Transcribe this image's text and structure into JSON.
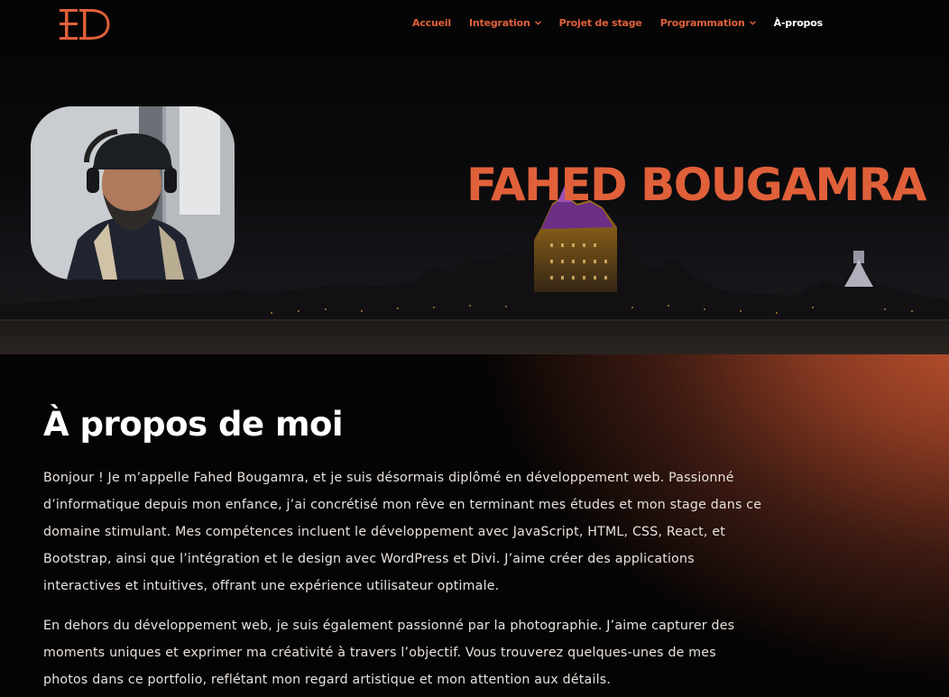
{
  "logo": {
    "text": "FD"
  },
  "nav": [
    {
      "label": "Accueil",
      "dropdown": false,
      "active": false
    },
    {
      "label": "Integration",
      "dropdown": true,
      "active": false
    },
    {
      "label": "Projet de stage",
      "dropdown": false,
      "active": false
    },
    {
      "label": "Programmation",
      "dropdown": true,
      "active": false
    },
    {
      "label": "À-propos",
      "dropdown": false,
      "active": true
    }
  ],
  "hero": {
    "name": "FAHED BOUGAMRA"
  },
  "about": {
    "title": "À propos de moi",
    "paragraphs": [
      "Bonjour ! Je m’appelle Fahed Bougamra, et je suis désormais diplômé en développement web. Passionné d’informatique depuis mon enfance, j’ai concrétisé mon rêve en terminant mes études et mon stage dans ce domaine stimulant. Mes compétences incluent le développement avec JavaScript, HTML, CSS, React, et Bootstrap, ainsi que l’intégration et le design avec WordPress et Divi. J’aime créer des applications interactives et intuitives, offrant une expérience utilisateur optimale.",
      "En dehors du développement web, je suis également passionné par la photographie. J’aime capturer des moments uniques et exprimer ma créativité à travers l’objectif. Vous trouverez quelques-unes de mes photos dans ce portfolio, reflétant mon regard artistique et mon attention aux détails."
    ]
  },
  "colors": {
    "accent": "#e0603a",
    "background": "#000000",
    "text": "#ffffff"
  },
  "icons": {
    "dropdown": "chevron-down-icon",
    "logo": "fd-monogram-logo"
  }
}
